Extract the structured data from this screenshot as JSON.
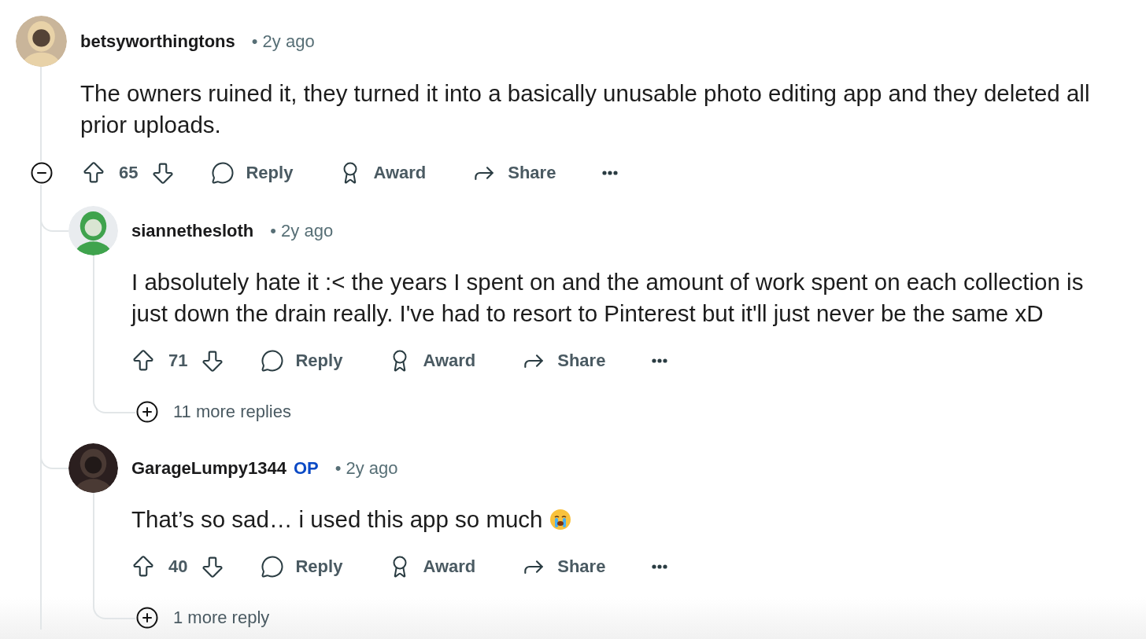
{
  "comments": [
    {
      "author": "betsyworthingtons",
      "meta": "• 2y ago",
      "body": "The owners ruined it, they turned it into a basically unusable photo editing app and they deleted all prior uploads.",
      "score": "65",
      "actions": {
        "reply": "Reply",
        "award": "Award",
        "share": "Share"
      },
      "expanded": true,
      "children": [
        {
          "author": "siannethesloth",
          "meta": "• 2y ago",
          "body": "I absolutely hate it :< the years I spent on and the amount of work spent on each collection is just down the drain really. I've had to resort to Pinterest but it'll just never be the same xD",
          "score": "71",
          "actions": {
            "reply": "Reply",
            "award": "Award",
            "share": "Share"
          },
          "more_replies": "11 more replies"
        },
        {
          "author": "GarageLumpy1344",
          "badge": "OP",
          "meta": "• 2y ago",
          "body": "That’s so sad… i used this app so much",
          "crying_emoji": true,
          "score": "40",
          "actions": {
            "reply": "Reply",
            "award": "Award",
            "share": "Share"
          },
          "more_replies": "1 more reply"
        }
      ]
    }
  ]
}
